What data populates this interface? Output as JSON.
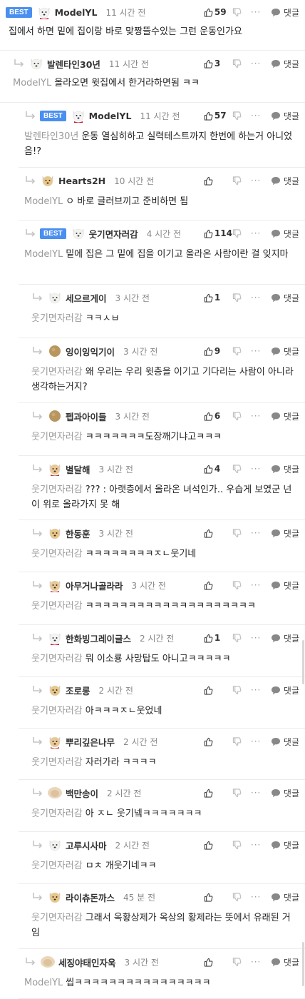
{
  "labels": {
    "best": "BEST",
    "reply": "댓글",
    "more": "···"
  },
  "colors": {
    "best_badge": "#4a8ff0",
    "mention": "#999999",
    "text": "#222222"
  },
  "comments": [
    {
      "level": 0,
      "best": true,
      "avatar": "samoyed-icon",
      "author": "ModelYL",
      "time": "11 시간 전",
      "likes": "59",
      "mention": "",
      "text": "집에서 하면 밑에 집이랑 바로 맞짱뜰수있는 그런 운동인가요"
    },
    {
      "level": 1,
      "best": false,
      "avatar": "dog-icon",
      "author": "발렌타인30년",
      "time": "11 시간 전",
      "likes": "3",
      "mention": "ModelYL",
      "text": "올라오면 윗집에서 한거라하면됨 ㅋㅋ"
    },
    {
      "level": 2,
      "best": true,
      "avatar": "samoyed-icon",
      "author": "ModelYL",
      "time": "11 시간 전",
      "likes": "57",
      "mention": "발렌타인30년",
      "text": "운동 열심히하고 실력테스트까지 한번에 하는거 아니었음!?"
    },
    {
      "level": 3,
      "best": false,
      "avatar": "retriever-icon",
      "author": "Hearts2H",
      "time": "10 시간 전",
      "likes": "",
      "mention": "ModelYL",
      "text": "ㅇ 바로 글러브끼고 준비하면 됨"
    },
    {
      "level": 3,
      "best": true,
      "avatar": "dog-icon",
      "author": "웃기면자러감",
      "time": "4 시간 전",
      "likes": "114",
      "mention": "ModelYL",
      "text": "밑에 집은 그 밑에 집을 이기고 올라온 사람이란 걸 잊지마"
    },
    {
      "level": 4,
      "best": false,
      "avatar": "dog-icon",
      "author": "세으르게이",
      "time": "3 시간 전",
      "likes": "1",
      "mention": "웃기면자러감",
      "text": "ㅋㅋㅅㅂ"
    },
    {
      "level": 4,
      "best": false,
      "avatar": "ball-icon",
      "author": "잉이잉익기이",
      "time": "3 시간 전",
      "likes": "9",
      "mention": "웃기면자러감",
      "text": "왜 우리는 우리 윗층을 이기고 기다리는 사람이 아니라 생각하는거지?"
    },
    {
      "level": 4,
      "best": false,
      "avatar": "ball-icon",
      "author": "펩과아이들",
      "time": "3 시간 전",
      "likes": "6",
      "mention": "웃기면자러감",
      "text": "ㅋㅋㅋㅋㅋㅋㅋ도장깨기냐고ㅋㅋㅋ"
    },
    {
      "level": 4,
      "best": false,
      "avatar": "red-dog-icon",
      "author": "별달해",
      "time": "3 시간 전",
      "likes": "4",
      "mention": "웃기면자러감",
      "text": "??? : 아랫층에서 올라온 녀석인가.. 우습게 보였군 넌 이 위로 올라가지 못 해"
    },
    {
      "level": 4,
      "best": false,
      "avatar": "retriever-icon",
      "author": "한동훈",
      "time": "3 시간 전",
      "likes": "",
      "mention": "웃기면자러감",
      "text": "ㅋㅋㅋㅋㅋㅋㅋㅋㅈㄴ웃기네"
    },
    {
      "level": 4,
      "best": false,
      "avatar": "red-dog-icon",
      "author": "아무거나골라라",
      "time": "3 시간 전",
      "likes": "",
      "mention": "웃기면자러감",
      "text": "ㅋㅋㅋㅋㅋㅋㅋㅋㅋㅋㅋㅋㅋㅋㅋㅋㅋㅋㅋㅋ"
    },
    {
      "level": 4,
      "best": false,
      "avatar": "samoyed-icon",
      "author": "한화빙그레이글스",
      "time": "2 시간 전",
      "likes": "1",
      "mention": "웃기면자러감",
      "text": "뭐 이소룡 사망탑도 아니고ㅋㅋㅋㅋㅋ"
    },
    {
      "level": 4,
      "best": false,
      "avatar": "retriever-icon",
      "author": "조로롱",
      "time": "2 시간 전",
      "likes": "",
      "mention": "웃기면자러감",
      "text": "아ㅋㅋㅋㅈㄴ웃었네"
    },
    {
      "level": 4,
      "best": false,
      "avatar": "red-dog-icon",
      "author": "뿌리깊은나무",
      "time": "2 시간 전",
      "likes": "",
      "mention": "웃기면자러감",
      "text": "자러가라 ㅋㅋㅋㅋ"
    },
    {
      "level": 4,
      "best": false,
      "avatar": "blurred-icon",
      "author": "백만송이",
      "time": "2 시간 전",
      "likes": "",
      "mention": "웃기면자러감",
      "text": "아 ㅈㄴ 웃기넼ㅋㅋㅋㅋㅋㅋㅋ"
    },
    {
      "level": 4,
      "best": false,
      "avatar": "dog-icon",
      "author": "고루시사마",
      "time": "2 시간 전",
      "likes": "",
      "mention": "웃기면자러감",
      "text": "ㅁㅊ 개웃기네ㅋㅋ"
    },
    {
      "level": 4,
      "best": false,
      "avatar": "retriever-icon",
      "author": "라이츄돈까스",
      "time": "45 분 전",
      "likes": "",
      "mention": "웃기면자러감",
      "text": "그래서 옥황상제가 옥상의 황제라는 뜻에서 유래된 거임"
    },
    {
      "level": 3,
      "best": false,
      "avatar": "blurred-icon",
      "author": "세징야태인자욱",
      "time": "3 시간 전",
      "likes": "",
      "mention": "ModelYL",
      "text": "씹ㅋㅋㅋㅋㅋㅋㅋㅋㅋㅋㅋㅋㅋㅋㅋㅋ"
    }
  ]
}
